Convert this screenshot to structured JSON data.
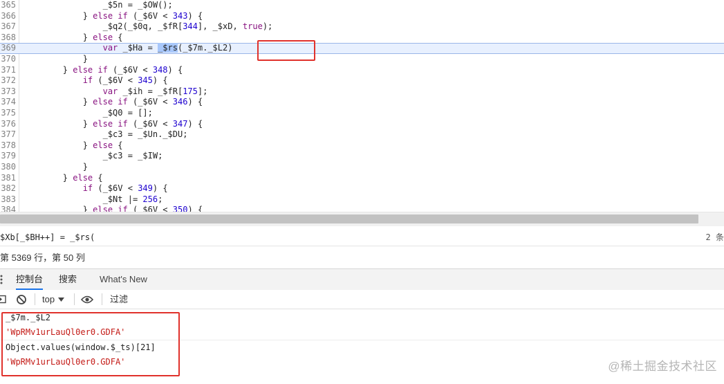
{
  "editor": {
    "lines": [
      {
        "num": "365",
        "tokens": [
          {
            "t": "                _$5n = _$OW();"
          }
        ]
      },
      {
        "num": "366",
        "tokens": [
          {
            "t": "            } "
          },
          {
            "t": "else if",
            "c": "kw"
          },
          {
            "t": " (_$6V < "
          },
          {
            "t": "343",
            "c": "num"
          },
          {
            "t": ") {"
          }
        ]
      },
      {
        "num": "367",
        "tokens": [
          {
            "t": "                _$q2(_$0q, _$fR["
          },
          {
            "t": "344",
            "c": "num"
          },
          {
            "t": "], _$xD, "
          },
          {
            "t": "true",
            "c": "kw"
          },
          {
            "t": ");"
          }
        ]
      },
      {
        "num": "368",
        "tokens": [
          {
            "t": "            } "
          },
          {
            "t": "else",
            "c": "kw"
          },
          {
            "t": " {"
          }
        ]
      },
      {
        "num": "369",
        "highlight": true,
        "tokens": [
          {
            "t": "                "
          },
          {
            "t": "var",
            "c": "kw"
          },
          {
            "t": " _$Ha = "
          },
          {
            "t": "_$rs",
            "c": "sel"
          },
          {
            "t": "(_$7m._$L2)"
          }
        ]
      },
      {
        "num": "370",
        "tokens": [
          {
            "t": "            }"
          }
        ]
      },
      {
        "num": "371",
        "tokens": [
          {
            "t": "        } "
          },
          {
            "t": "else if",
            "c": "kw"
          },
          {
            "t": " (_$6V < "
          },
          {
            "t": "348",
            "c": "num"
          },
          {
            "t": ") {"
          }
        ]
      },
      {
        "num": "372",
        "tokens": [
          {
            "t": "            "
          },
          {
            "t": "if",
            "c": "kw"
          },
          {
            "t": " (_$6V < "
          },
          {
            "t": "345",
            "c": "num"
          },
          {
            "t": ") {"
          }
        ]
      },
      {
        "num": "373",
        "tokens": [
          {
            "t": "                "
          },
          {
            "t": "var",
            "c": "kw"
          },
          {
            "t": " _$ih = _$fR["
          },
          {
            "t": "175",
            "c": "num"
          },
          {
            "t": "];"
          }
        ]
      },
      {
        "num": "374",
        "tokens": [
          {
            "t": "            } "
          },
          {
            "t": "else if",
            "c": "kw"
          },
          {
            "t": " (_$6V < "
          },
          {
            "t": "346",
            "c": "num"
          },
          {
            "t": ") {"
          }
        ]
      },
      {
        "num": "375",
        "tokens": [
          {
            "t": "                _$Q0 = [];"
          }
        ]
      },
      {
        "num": "376",
        "tokens": [
          {
            "t": "            } "
          },
          {
            "t": "else if",
            "c": "kw"
          },
          {
            "t": " (_$6V < "
          },
          {
            "t": "347",
            "c": "num"
          },
          {
            "t": ") {"
          }
        ]
      },
      {
        "num": "377",
        "tokens": [
          {
            "t": "                _$c3 = _$Un._$DU;"
          }
        ]
      },
      {
        "num": "378",
        "tokens": [
          {
            "t": "            } "
          },
          {
            "t": "else",
            "c": "kw"
          },
          {
            "t": " {"
          }
        ]
      },
      {
        "num": "379",
        "tokens": [
          {
            "t": "                _$c3 = _$IW;"
          }
        ]
      },
      {
        "num": "380",
        "tokens": [
          {
            "t": "            }"
          }
        ]
      },
      {
        "num": "381",
        "tokens": [
          {
            "t": "        } "
          },
          {
            "t": "else",
            "c": "kw"
          },
          {
            "t": " {"
          }
        ]
      },
      {
        "num": "382",
        "tokens": [
          {
            "t": "            "
          },
          {
            "t": "if",
            "c": "kw"
          },
          {
            "t": " (_$6V < "
          },
          {
            "t": "349",
            "c": "num"
          },
          {
            "t": ") {"
          }
        ]
      },
      {
        "num": "383",
        "tokens": [
          {
            "t": "                _$Nt |= "
          },
          {
            "t": "256",
            "c": "num"
          },
          {
            "t": ";"
          }
        ]
      },
      {
        "num": "384",
        "tokens": [
          {
            "t": "            } "
          },
          {
            "t": "else if",
            "c": "kw"
          },
          {
            "t": " (_$6V < "
          },
          {
            "t": "350",
            "c": "num"
          },
          {
            "t": ") {"
          }
        ]
      }
    ]
  },
  "search": {
    "query": "$Xb[_$BH++] = _$rs(",
    "match_count": "2 条"
  },
  "status": {
    "cursor_position": "第 5369 行，第 50 列"
  },
  "drawer": {
    "tabs": [
      {
        "label": "控制台",
        "active": true
      },
      {
        "label": "搜索",
        "active": false
      },
      {
        "label": "What's New",
        "active": false
      }
    ]
  },
  "console_toolbar": {
    "context": "top",
    "filter_placeholder": "过滤"
  },
  "console": {
    "messages": [
      {
        "kind": "input",
        "text": "_$7m._$L2"
      },
      {
        "kind": "result",
        "text": "'WpRMv1urLauQl0er0.GDFA'"
      },
      {
        "kind": "input",
        "text": "Object.values(window.$_ts)[21]"
      },
      {
        "kind": "result",
        "text": "'WpRMv1urLauQl0er0.GDFA'"
      }
    ]
  },
  "watermark": "@稀土掘金技术社区",
  "colors": {
    "accent": "#1a73e8",
    "annotation_red": "#e0312b",
    "keyword": "#881280",
    "number": "#1c00cf",
    "string_result": "#c41a16"
  }
}
